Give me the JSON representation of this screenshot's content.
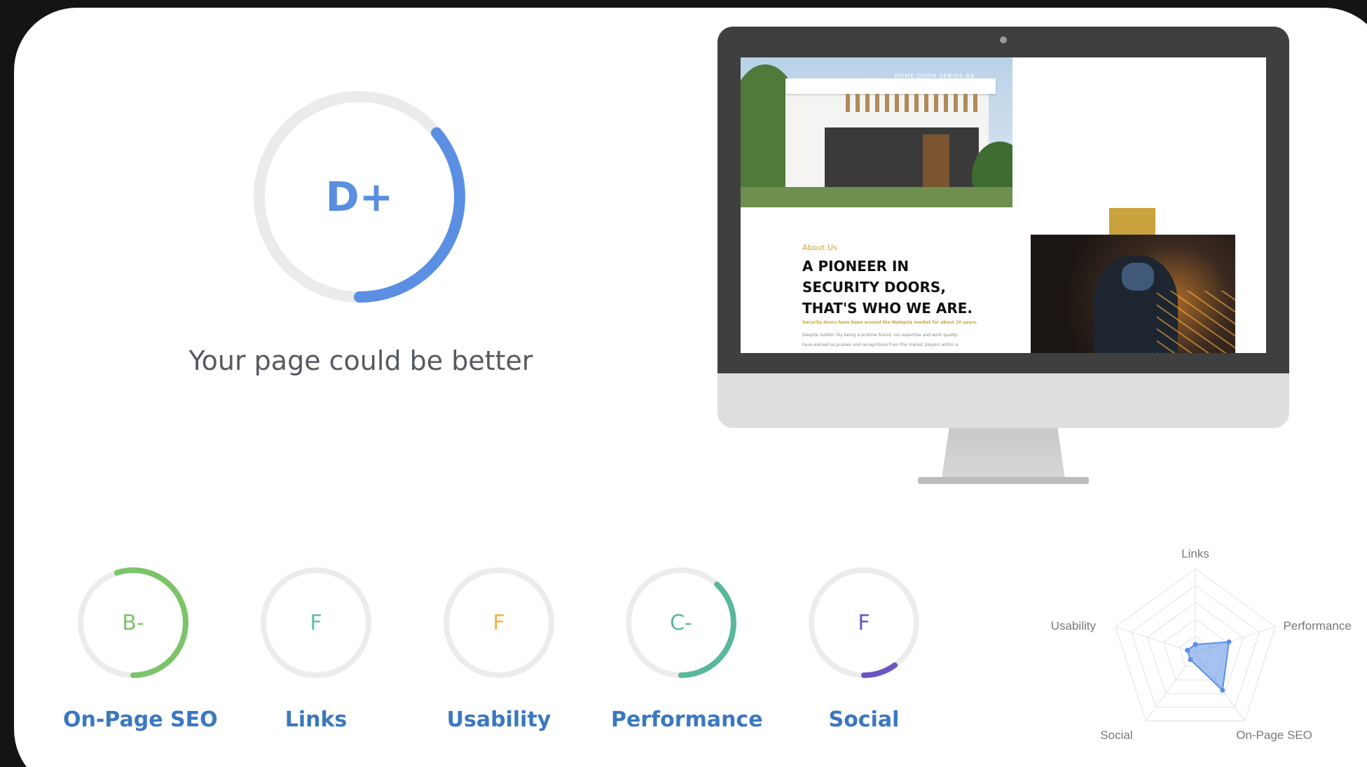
{
  "overall": {
    "grade": "D+",
    "message": "Your page could be better",
    "score_fraction": 0.36,
    "color": "#5b8fe3"
  },
  "preview": {
    "hero_nav": "HOME    DOOR SERIES    AB",
    "about_label": "About Us",
    "headline_lines": [
      "A PIONEER IN",
      "SECURITY DOORS,",
      "THAT'S WHO WE ARE."
    ],
    "subheadline": "Security doors have been around the Malaysia market for about 20 years.",
    "body_lines": [
      "Despite Golden Toy being a pristine brand, our expertise and work quality",
      "have earned us praises and recognitions from the market players within a"
    ]
  },
  "categories": [
    {
      "name": "On-Page SEO",
      "grade": "B-",
      "color": "#7cc46a",
      "score_fraction": 0.55
    },
    {
      "name": "Links",
      "grade": "F",
      "color": "#5cbfa8",
      "score_fraction": 0.0
    },
    {
      "name": "Usability",
      "grade": "F",
      "color": "#f0b040",
      "score_fraction": 0.0
    },
    {
      "name": "Performance",
      "grade": "C-",
      "color": "#59b79c",
      "score_fraction": 0.38
    },
    {
      "name": "Social",
      "grade": "F",
      "color": "#6b55c2",
      "score_fraction": 0.1
    }
  ],
  "radar": {
    "axes": [
      "Links",
      "Performance",
      "On-Page SEO",
      "Social",
      "Usability"
    ],
    "values": [
      0.1,
      0.42,
      0.55,
      0.1,
      0.1
    ],
    "color": "#5b8fe3"
  }
}
